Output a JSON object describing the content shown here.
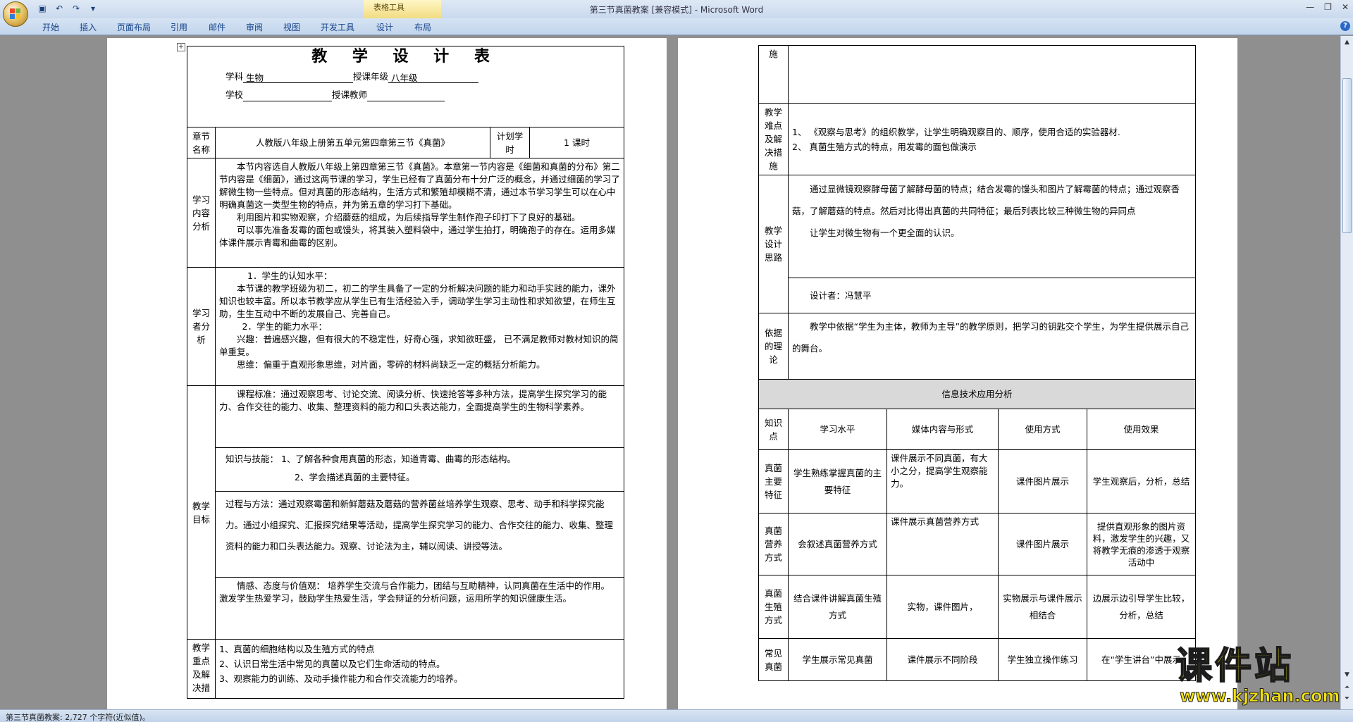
{
  "window": {
    "title": "第三节真菌教案 [兼容模式] - Microsoft Word",
    "context_tab": "表格工具"
  },
  "ribbon": {
    "tabs": [
      "开始",
      "插入",
      "页面布局",
      "引用",
      "邮件",
      "审阅",
      "视图",
      "开发工具",
      "设计",
      "布局"
    ]
  },
  "status": {
    "text": "第三节真菌教案: 2,727 个字符(近似值)。"
  },
  "page1": {
    "title": "教 学 设 计 表",
    "subject_label": "学科",
    "subject_value": "生物",
    "grade_label": "授课年级",
    "grade_value": "八年级",
    "school_label": "学校",
    "teacher_label": "授课教师",
    "chapter_label": "章节名称",
    "chapter_value": "人教版八年级上册第五单元第四章第三节《真菌》",
    "period_label": "计划学时",
    "period_value": "1 课时",
    "content_label": "学习内容分析",
    "content_p1": "本节内容选自人教版八年级上第四章第三节《真菌》。本章第一节内容是《细菌和真菌的分布》第二节内容是《细菌》，通过这两节课的学习，学生已经有了真菌分布十分广泛的概念，并通过细菌的学习了解微生物一些特点。但对真菌的形态结构，生活方式和繁殖却模糊不清，通过本节学习学生可以在心中明确真菌这一类型生物的特点，并为第五章的学习打下基础。",
    "content_p2": "利用图片和实物观察，介绍蘑菇的组成，为后续指导学生制作孢子印打下了良好的基础。",
    "content_p3": "可以事先准备发霉的面包或馒头，将其装入塑料袋中，通过学生拍打，明确孢子的存在。运用多媒体课件展示青霉和曲霉的区别。",
    "learner_label": "学习者分析",
    "learner_h1": "1．学生的认知水平：",
    "learner_p1": "本节课的教学班级为初二，初二的学生具备了一定的分析解决问题的能力和动手实践的能力，课外知识也较丰富。所以本节教学应从学生已有生活经验入手，调动学生学习主动性和求知欲望，在师生互助，生生互动中不断的发展自己、完善自己。",
    "learner_h2": "2．学生的能力水平：",
    "learner_p2": "兴趣：普遍感兴趣，但有很大的不稳定性，好奇心强，求知欲旺盛， 已不满足教师对教材知识的简单重复。",
    "learner_p3": "思维：偏重于直观形象思维，对片面，零碎的材料尚缺乏一定的概括分析能力。",
    "goal_label": "教学目标",
    "goal_standard": "课程标准：通过观察思考、讨论交流、阅读分析、快速抢答等多种方法，提高学生探究学习的能力、合作交往的能力、收集、整理资料的能力和口头表达能力，全面提高学生的生物科学素养。",
    "goal_knowledge_1": "知识与技能： 1、了解各种食用真菌的形态，知道青霉、曲霉的形态结构。",
    "goal_knowledge_2": "2、学会描述真菌的主要特征。",
    "goal_process": "过程与方法：通过观察霉菌和新鲜蘑菇及蘑菇的营养菌丝培养学生观察、思考、动手和科学探究能力。通过小组探究、汇报探究结果等活动，提高学生探究学习的能力、合作交往的能力、收集、整理资料的能力和口头表达能力。观察、讨论法为主，辅以阅读、讲授等法。",
    "goal_emotion": "情感、态度与价值观： 培养学生交流与合作能力，团结与互助精神，认同真菌在生活中的作用。　 激发学生热爱学习，鼓励学生热爱生活，学会辩证的分析问题，运用所学的知识健康生活。",
    "key_label": "教学重点及解决措",
    "key_1": "1、真菌的细胞结构以及生殖方式的特点",
    "key_2": "2、认识日常生活中常见的真菌以及它们生命活动的特点。",
    "key_3": "3、观察能力的训练、及动手操作能力和合作交流能力的培养。"
  },
  "page2": {
    "shi_label": "施",
    "diff_label": "教学难点及解决措施",
    "diff_1": "1、 《观察与思考》的组织教学，让学生明确观察目的、顺序，使用合适的实验器材.",
    "diff_2": "2、 真菌生殖方式的特点，用发霉的面包做演示",
    "design_label": "教学设计思路",
    "design_p1": "通过显微镜观察酵母菌了解酵母菌的特点；结合发霉的馒头和图片了解霉菌的特点；通过观察香菇，了解蘑菇的特点。然后对比得出真菌的共同特征；最后列表比较三种微生物的异同点",
    "design_p2": "让学生对微生物有一个更全面的认识。",
    "designer": "设计者：冯慧平",
    "basis_label": "依据的理论",
    "basis_p1": "教学中依据“学生为主体，教师为主导”的教学原则，把学习的钥匙交个学生，为学生提供展示自己的舞台。",
    "it_header": "信息技术应用分析",
    "columns": [
      "知识点",
      "学习水平",
      "媒体内容与形式",
      "使用方式",
      "使用效果"
    ],
    "rows": [
      [
        "真菌主要特征",
        "学生熟练掌握真菌的主要特征",
        "课件展示不同真菌，有大小之分，提高学生观察能力。",
        "课件图片展示",
        "学生观察后，分析，总结"
      ],
      [
        "真菌营养方式",
        "会叙述真菌营养方式",
        "课件展示真菌营养方式",
        "课件图片展示",
        "提供直观形象的图片资料，激发学生的兴趣，又将教学无痕的渗透于观察活动中"
      ],
      [
        "真菌生殖方式",
        "结合课件讲解真菌生殖方式",
        "实物，课件图片，",
        "实物展示与课件展示相结合",
        "边展示边引导学生比较，分析，总结"
      ],
      [
        "常见真菌",
        "学生展示常见真菌",
        "课件展示不同阶段",
        "学生独立操作练习",
        "在“学生讲台”中展示"
      ]
    ]
  },
  "watermark": {
    "main": "课件站",
    "url": "www.kjzhan.com"
  }
}
